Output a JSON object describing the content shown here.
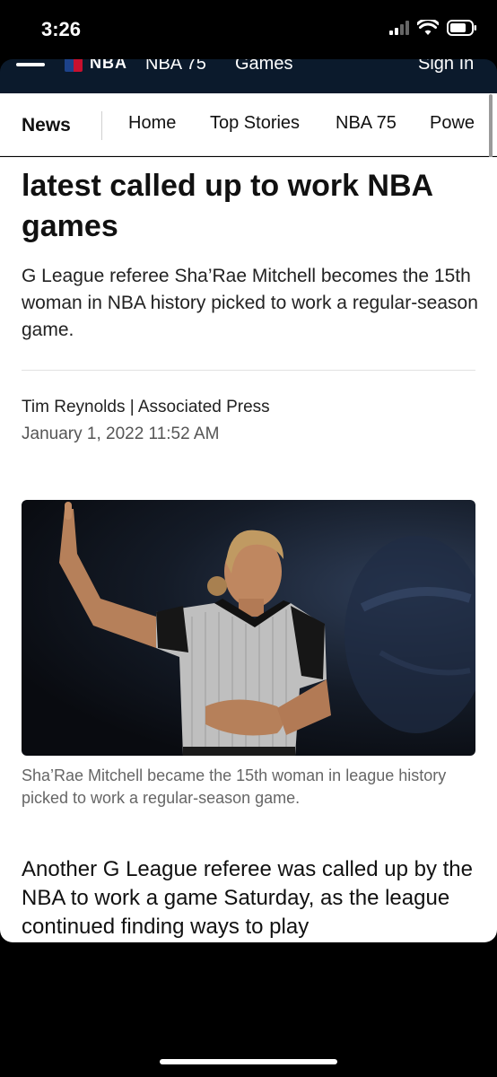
{
  "status_bar": {
    "time": "3:26"
  },
  "site_header": {
    "logo_text": "NBA",
    "links": [
      "NBA 75",
      "Games",
      "Sign In"
    ]
  },
  "secondary_nav": {
    "section": "News",
    "items": [
      "Home",
      "Top Stories",
      "NBA 75",
      "Powe"
    ]
  },
  "article": {
    "headline": "latest called up to work NBA games",
    "subhead": "G League referee Sha’Rae Mitchell becomes the 15th woman in NBA history picked to work a regular-season game.",
    "byline": "Tim Reynolds | Associated Press",
    "date": "January 1, 2022 11:52 AM",
    "image_caption": "Sha’Rae Mitchell became the 15th woman in league history picked to work a regular-season game.",
    "body": "Another G League referee was called up by the NBA to work a game Saturday, as the league continued finding ways to play"
  },
  "colors": {
    "header_bg": "#0b1a2c",
    "page_bg": "#ffffff",
    "text": "#111111"
  }
}
